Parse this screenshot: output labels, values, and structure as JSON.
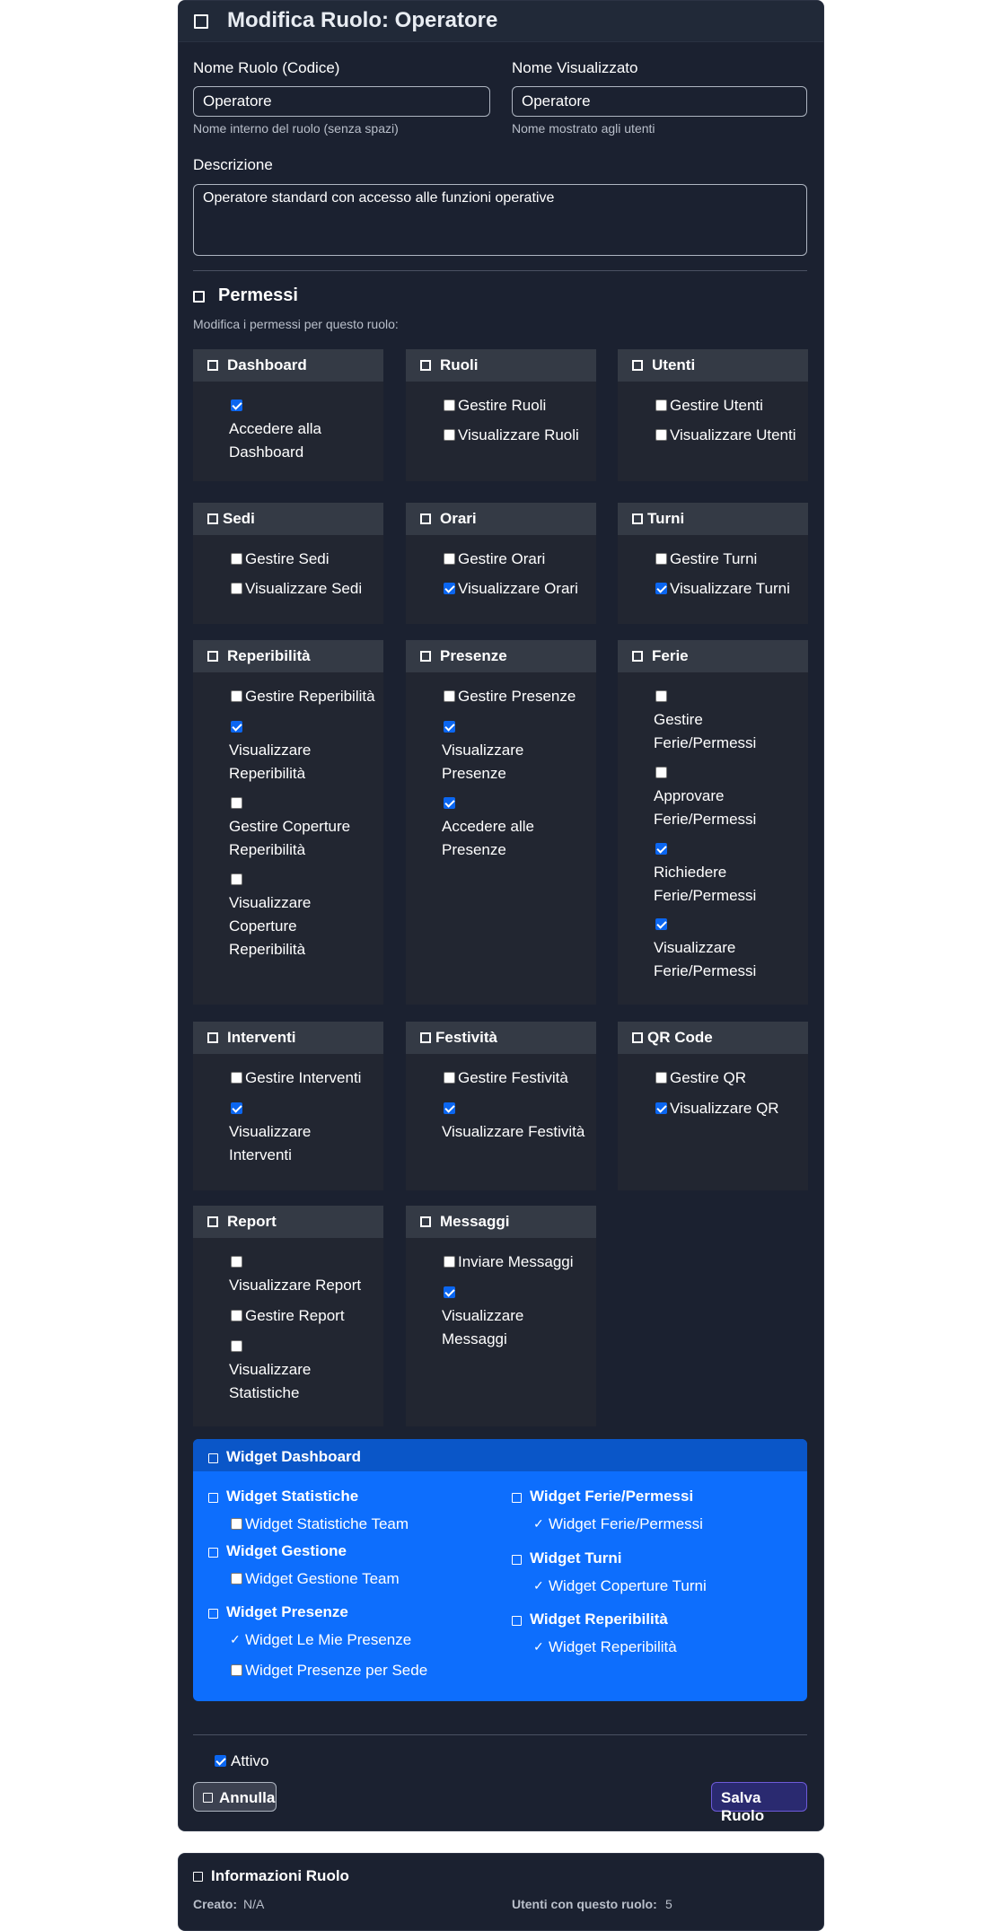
{
  "header": {
    "title": "Modifica Ruolo: Operatore"
  },
  "form": {
    "name_label": "Nome Ruolo (Codice)",
    "name_value": "Operatore",
    "name_help": "Nome interno del ruolo (senza spazi)",
    "display_label": "Nome Visualizzato",
    "display_value": "Operatore",
    "display_help": "Nome mostrato agli utenti",
    "desc_label": "Descrizione",
    "desc_value": "Operatore standard con accesso alle funzioni operative"
  },
  "permissions": {
    "title": "Permessi",
    "subtitle": "Modifica i permessi per questo ruolo:",
    "groups": [
      {
        "name": "Dashboard",
        "items": [
          {
            "label": "Accedere alla Dashboard",
            "checked": true
          }
        ]
      },
      {
        "name": "Ruoli",
        "items": [
          {
            "label": "Gestire Ruoli",
            "checked": false
          },
          {
            "label": "Visualizzare Ruoli",
            "checked": false
          }
        ]
      },
      {
        "name": "Utenti",
        "items": [
          {
            "label": "Gestire Utenti",
            "checked": false
          },
          {
            "label": "Visualizzare Utenti",
            "checked": false
          }
        ]
      },
      {
        "name": "Sedi",
        "items": [
          {
            "label": "Gestire Sedi",
            "checked": false
          },
          {
            "label": "Visualizzare Sedi",
            "checked": false
          }
        ]
      },
      {
        "name": "Orari",
        "items": [
          {
            "label": "Gestire Orari",
            "checked": false
          },
          {
            "label": "Visualizzare Orari",
            "checked": true
          }
        ]
      },
      {
        "name": "Turni",
        "items": [
          {
            "label": "Gestire Turni",
            "checked": false
          },
          {
            "label": "Visualizzare Turni",
            "checked": true
          }
        ]
      },
      {
        "name": "Reperibilità",
        "items": [
          {
            "label": "Gestire Reperibilità",
            "checked": false
          },
          {
            "label": "Visualizzare Reperibilità",
            "checked": true
          },
          {
            "label": "Gestire Coperture Reperibilità",
            "checked": false
          },
          {
            "label": "Visualizzare Coperture Reperibilità",
            "checked": false
          }
        ]
      },
      {
        "name": "Presenze",
        "items": [
          {
            "label": "Gestire Presenze",
            "checked": false
          },
          {
            "label": "Visualizzare Presenze",
            "checked": true
          },
          {
            "label": "Accedere alle Presenze",
            "checked": true
          }
        ]
      },
      {
        "name": "Ferie",
        "items": [
          {
            "label": "Gestire Ferie/Permessi",
            "checked": false
          },
          {
            "label": "Approvare Ferie/Permessi",
            "checked": false
          },
          {
            "label": "Richiedere Ferie/Permessi",
            "checked": true
          },
          {
            "label": "Visualizzare Ferie/Permessi",
            "checked": true
          }
        ]
      },
      {
        "name": "Interventi",
        "items": [
          {
            "label": "Gestire Interventi",
            "checked": false
          },
          {
            "label": "Visualizzare Interventi",
            "checked": true
          }
        ]
      },
      {
        "name": "Festività",
        "items": [
          {
            "label": "Gestire Festività",
            "checked": false
          },
          {
            "label": "Visualizzare Festività",
            "checked": true
          }
        ]
      },
      {
        "name": "QR Code",
        "items": [
          {
            "label": "Gestire QR",
            "checked": false
          },
          {
            "label": "Visualizzare QR",
            "checked": true
          }
        ]
      },
      {
        "name": "Report",
        "items": [
          {
            "label": "Visualizzare Report",
            "checked": false
          },
          {
            "label": "Gestire Report",
            "checked": false
          },
          {
            "label": "Visualizzare Statistiche",
            "checked": false
          }
        ]
      },
      {
        "name": "Messaggi",
        "items": [
          {
            "label": "Inviare Messaggi",
            "checked": false
          },
          {
            "label": "Visualizzare Messaggi",
            "checked": true
          }
        ]
      }
    ]
  },
  "widgets": {
    "title": "Widget Dashboard",
    "left": [
      {
        "group": "Widget Statistiche",
        "items": [
          {
            "label": "Widget Statistiche Team",
            "checked": false
          }
        ]
      },
      {
        "group": "Widget Gestione",
        "items": [
          {
            "label": "Widget Gestione Team",
            "checked": false
          }
        ]
      },
      {
        "group": "Widget Presenze",
        "items": [
          {
            "label": "Widget Le Mie Presenze",
            "checked": true
          },
          {
            "label": "Widget Presenze per Sede",
            "checked": false
          }
        ]
      }
    ],
    "right": [
      {
        "group": "Widget Ferie/Permessi",
        "items": [
          {
            "label": "Widget Ferie/Permessi",
            "checked": true
          }
        ]
      },
      {
        "group": "Widget Turni",
        "items": [
          {
            "label": "Widget Coperture Turni",
            "checked": true
          }
        ]
      },
      {
        "group": "Widget Reperibilità",
        "items": [
          {
            "label": "Widget Reperibilità",
            "checked": true
          }
        ]
      }
    ]
  },
  "active": {
    "label": "Attivo",
    "checked": true
  },
  "buttons": {
    "cancel": "Annulla",
    "save": "Salva Ruolo"
  },
  "info": {
    "title": "Informazioni Ruolo",
    "created_label": "Creato:",
    "created_value": "N/A",
    "users_label": "Utenti con questo ruolo:",
    "users_value": "5"
  }
}
